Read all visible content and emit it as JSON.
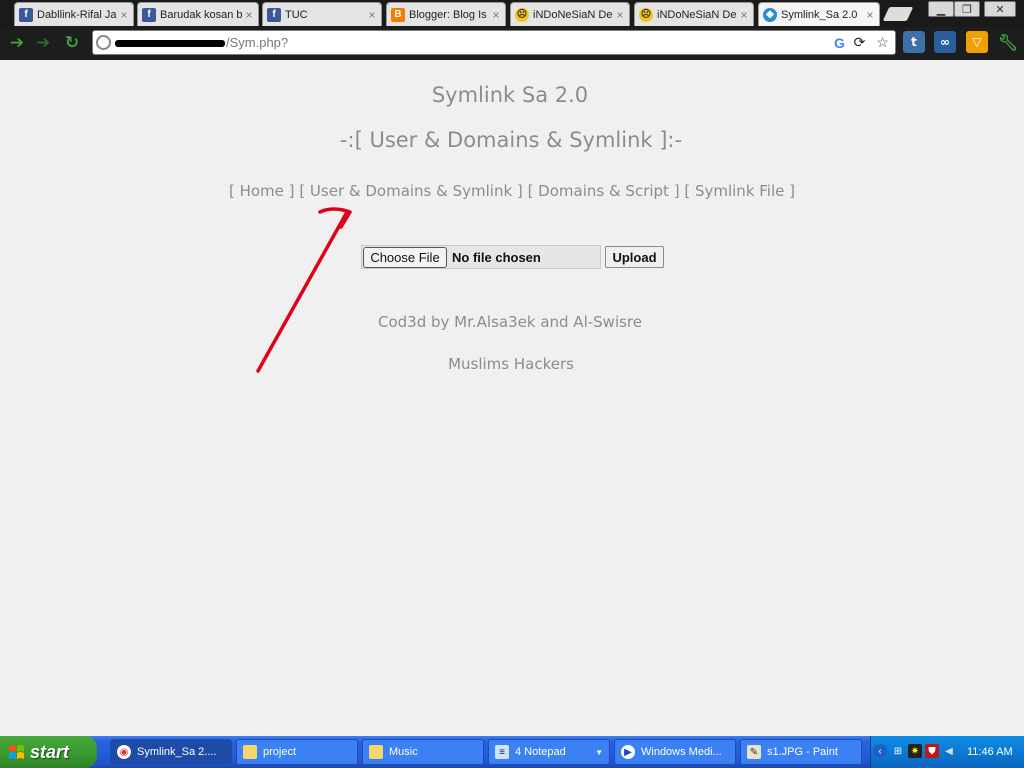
{
  "browser": {
    "tabs": [
      {
        "title": "Dabllink-Rifal Ja",
        "favicon": "facebook-icon",
        "active": false
      },
      {
        "title": "Barudak kosan b",
        "favicon": "facebook-icon",
        "active": false
      },
      {
        "title": "TUC",
        "favicon": "facebook-icon",
        "active": false
      },
      {
        "title": "Blogger: Blog Is",
        "favicon": "blogger-icon",
        "active": false
      },
      {
        "title": "iNDoNeSiaN DeF",
        "favicon": "emoji-icon",
        "active": false
      },
      {
        "title": "iNDoNeSiaN DeF",
        "favicon": "emoji-icon",
        "active": false
      },
      {
        "title": "Symlink_Sa 2.0",
        "favicon": "globe-icon",
        "active": true
      }
    ],
    "close_glyph": "×",
    "address": {
      "visible_text": "/Sym.php?"
    },
    "colors": {
      "nav_arrows": "#3da33d",
      "frame": "#1a1a1a"
    }
  },
  "page": {
    "site_title": "Symlink Sa 2.0",
    "section_title": "-:[ User & Domains & Symlink ]:-",
    "nav": [
      {
        "label": "[ Home ]"
      },
      {
        "label": "[ User & Domains & Symlink ]"
      },
      {
        "label": "[ Domains & Script ]"
      },
      {
        "label": "[ Symlink File ]"
      }
    ],
    "upload": {
      "choose_label": "Choose File",
      "status": "No file chosen",
      "upload_label": "Upload"
    },
    "credit": "Cod3d by Mr.Alsa3ek and Al-Swisre",
    "team": "Muslims Hackers",
    "colors": {
      "text": "#8c8c8c",
      "background": "#f0f0f0",
      "annotation_arrow": "#e0001a"
    }
  },
  "taskbar": {
    "start_label": "start",
    "items": [
      {
        "label": "Symlink_Sa 2....",
        "icon": "chrome-icon",
        "active": true
      },
      {
        "label": "project",
        "icon": "folder-icon",
        "active": false
      },
      {
        "label": "Music",
        "icon": "folder-icon",
        "active": false
      },
      {
        "label": "4 Notepad",
        "icon": "notepad-icon",
        "active": false
      },
      {
        "label": "Windows Medi...",
        "icon": "media-player-icon",
        "active": false
      },
      {
        "label": "s1.JPG - Paint",
        "icon": "paint-icon",
        "active": false
      }
    ],
    "clock": "11:46 AM"
  }
}
